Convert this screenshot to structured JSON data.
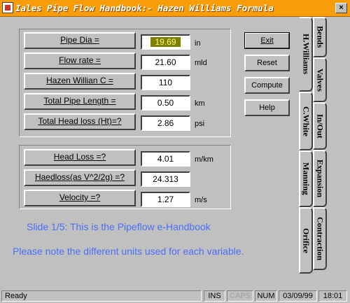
{
  "window": {
    "title": "Iales Pipe Flow Handbook:- Hazen Williams Formula",
    "close_label": "×"
  },
  "inputs": [
    {
      "label": "Pipe Dia =",
      "value": "19.69",
      "unit": "in"
    },
    {
      "label": "Flow rate =",
      "value": "21.60",
      "unit": "mld"
    },
    {
      "label": "Hazen Willian C =",
      "value": "110",
      "unit": ""
    },
    {
      "label": "Total Pipe Length =",
      "value": "0.50",
      "unit": "km"
    },
    {
      "label": "Total Head loss (Ht)=?",
      "value": "2.86",
      "unit": "psi"
    }
  ],
  "results": [
    {
      "label": "Head Loss =?",
      "value": "4.01",
      "unit": "m/km"
    },
    {
      "label": "Haedloss(as V^2/2g) =?",
      "value": "24.313",
      "unit": ""
    },
    {
      "label": "Velocity =?",
      "value": "1.27",
      "unit": "m/s"
    }
  ],
  "buttons": {
    "exit": "Exit",
    "reset": "Reset",
    "compute": "Compute",
    "help": "Help"
  },
  "tabs": {
    "col1": [
      "H.Williams",
      "C.White",
      "Manning",
      "Orifice"
    ],
    "col2": [
      "Bends",
      "Valves",
      "In/Out",
      "Expansion",
      "Contraction"
    ]
  },
  "messages": {
    "slide": "Slide 1/5: This is the Pipeflow e-Handbook",
    "note": "Please note the different units used for each variable."
  },
  "status": {
    "text": "Ready",
    "ins": "INS",
    "caps": "CAPS",
    "num": "NUM",
    "date": "03/09/99",
    "time": "18:01"
  },
  "colors": {
    "titlebar": "#f89c08",
    "message_text": "#4a6ef8",
    "selected_value_bg": "#808000"
  }
}
